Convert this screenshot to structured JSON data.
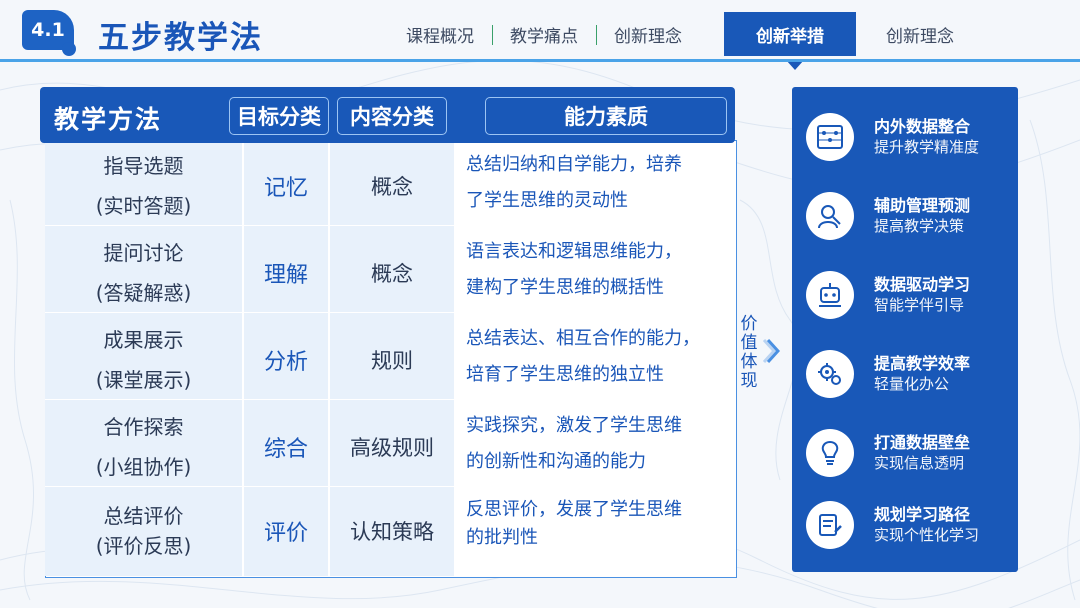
{
  "header": {
    "badge": "4.1",
    "title": "五步教学法",
    "tabs": [
      {
        "label": "课程概况",
        "active": false
      },
      {
        "label": "教学痛点",
        "active": false
      },
      {
        "label": "创新理念",
        "active": false
      },
      {
        "label": "创新举措",
        "active": true
      },
      {
        "label": "创新理念",
        "active": false
      }
    ]
  },
  "table": {
    "header": {
      "method": "教学方法",
      "target": "目标分类",
      "content": "内容分类",
      "ability": "能力素质"
    },
    "rows": [
      {
        "method": [
          "指导选题",
          "(实时答题)"
        ],
        "target": "记忆",
        "content": "概念",
        "ability": [
          "总结归纳和自学能力，培养",
          "了学生思维的灵动性"
        ]
      },
      {
        "method": [
          "提问讨论",
          "(答疑解惑)"
        ],
        "target": "理解",
        "content": "概念",
        "ability": [
          "语言表达和逻辑思维能力，",
          "建构了学生思维的概括性"
        ]
      },
      {
        "method": [
          "成果展示",
          "(课堂展示)"
        ],
        "target": "分析",
        "content": "规则",
        "ability": [
          "总结表达、相互合作的能力，",
          "培育了学生思维的独立性"
        ]
      },
      {
        "method": [
          "合作探索",
          "(小组协作)"
        ],
        "target": "综合",
        "content": "高级规则",
        "ability": [
          "实践探究，激发了学生思维",
          "的创新性和沟通的能力"
        ]
      },
      {
        "method": [
          "总结评价",
          "(评价反思)"
        ],
        "target": "评价",
        "content": "认知策略",
        "ability": [
          "反思评价，发展了学生思维",
          "的批判性"
        ]
      }
    ]
  },
  "value_label": "价值体现",
  "benefits": [
    {
      "icon": "abacus-icon",
      "title": "内外数据整合",
      "subtitle": "提升教学精准度"
    },
    {
      "icon": "analysis-person-icon",
      "title": "辅助管理预测",
      "subtitle": "提高教学决策"
    },
    {
      "icon": "learning-robot-icon",
      "title": "数据驱动学习",
      "subtitle": "智能学伴引导"
    },
    {
      "icon": "efficiency-gears-icon",
      "title": "提高教学效率",
      "subtitle": "轻量化办公"
    },
    {
      "icon": "lightbulb-icon",
      "title": "打通数据壁垒",
      "subtitle": "实现信息透明"
    },
    {
      "icon": "path-planning-icon",
      "title": "规划学习路径",
      "subtitle": "实现个性化学习"
    }
  ],
  "colors": {
    "primary": "#1958b8",
    "accent": "#4aa3e8",
    "text": "#2b3a55",
    "cell_bg": "#e8f1fb"
  }
}
